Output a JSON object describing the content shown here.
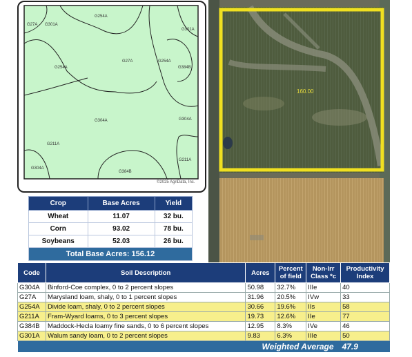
{
  "soil_map": {
    "labels": [
      "G27A",
      "G301A",
      "G254A",
      "G301A",
      "G254A",
      "G27A",
      "G254A",
      "G384B",
      "G304A",
      "G304A",
      "G211A",
      "G211A",
      "G304A",
      "G384B"
    ],
    "copyright": "©2025 AgriData, Inc."
  },
  "aerial": {
    "field_label": "160.00",
    "colors": {
      "boundary": "#f0e020",
      "field_dark": "#4d5a3c",
      "field_tan": "#b89a63"
    }
  },
  "crop_table": {
    "headers": [
      "Crop",
      "Base Acres",
      "Yield"
    ],
    "rows": [
      {
        "crop": "Wheat",
        "acres": "11.07",
        "yield": "32 bu."
      },
      {
        "crop": "Corn",
        "acres": "93.02",
        "yield": "78 bu."
      },
      {
        "crop": "Soybeans",
        "acres": "52.03",
        "yield": "26 bu."
      }
    ],
    "total": "Total Base Acres:  156.12"
  },
  "soil_table": {
    "headers": [
      "Code",
      "Soil Description",
      "Acres",
      "Percent of field",
      "Non-Irr Class *c",
      "Productivity Index"
    ],
    "rows": [
      {
        "code": "G304A",
        "desc": "Binford-Coe complex, 0 to 2 percent slopes",
        "acres": "50.98",
        "pct": "32.7%",
        "cls": "IIIe",
        "pi": "40",
        "hl": false
      },
      {
        "code": "G27A",
        "desc": "Marysland loam, shaly, 0 to 1 percent slopes",
        "acres": "31.96",
        "pct": "20.5%",
        "cls": "IVw",
        "pi": "33",
        "hl": false
      },
      {
        "code": "G254A",
        "desc": "Divide loam, shaly, 0 to 2 percent slopes",
        "acres": "30.66",
        "pct": "19.6%",
        "cls": "IIs",
        "pi": "58",
        "hl": true
      },
      {
        "code": "G211A",
        "desc": "Fram-Wyard loams, 0 to 3 percent slopes",
        "acres": "19.73",
        "pct": "12.6%",
        "cls": "IIe",
        "pi": "77",
        "hl": true
      },
      {
        "code": "G384B",
        "desc": "Maddock-Hecla loamy fine sands, 0 to 6 percent slopes",
        "acres": "12.95",
        "pct": "8.3%",
        "cls": "IVe",
        "pi": "46",
        "hl": false
      },
      {
        "code": "G301A",
        "desc": "Walum sandy loam, 0 to 2 percent slopes",
        "acres": "9.83",
        "pct": "6.3%",
        "cls": "IIIe",
        "pi": "50",
        "hl": true
      }
    ],
    "weighted_label": "Weighted Average",
    "weighted_value": "47.9"
  }
}
